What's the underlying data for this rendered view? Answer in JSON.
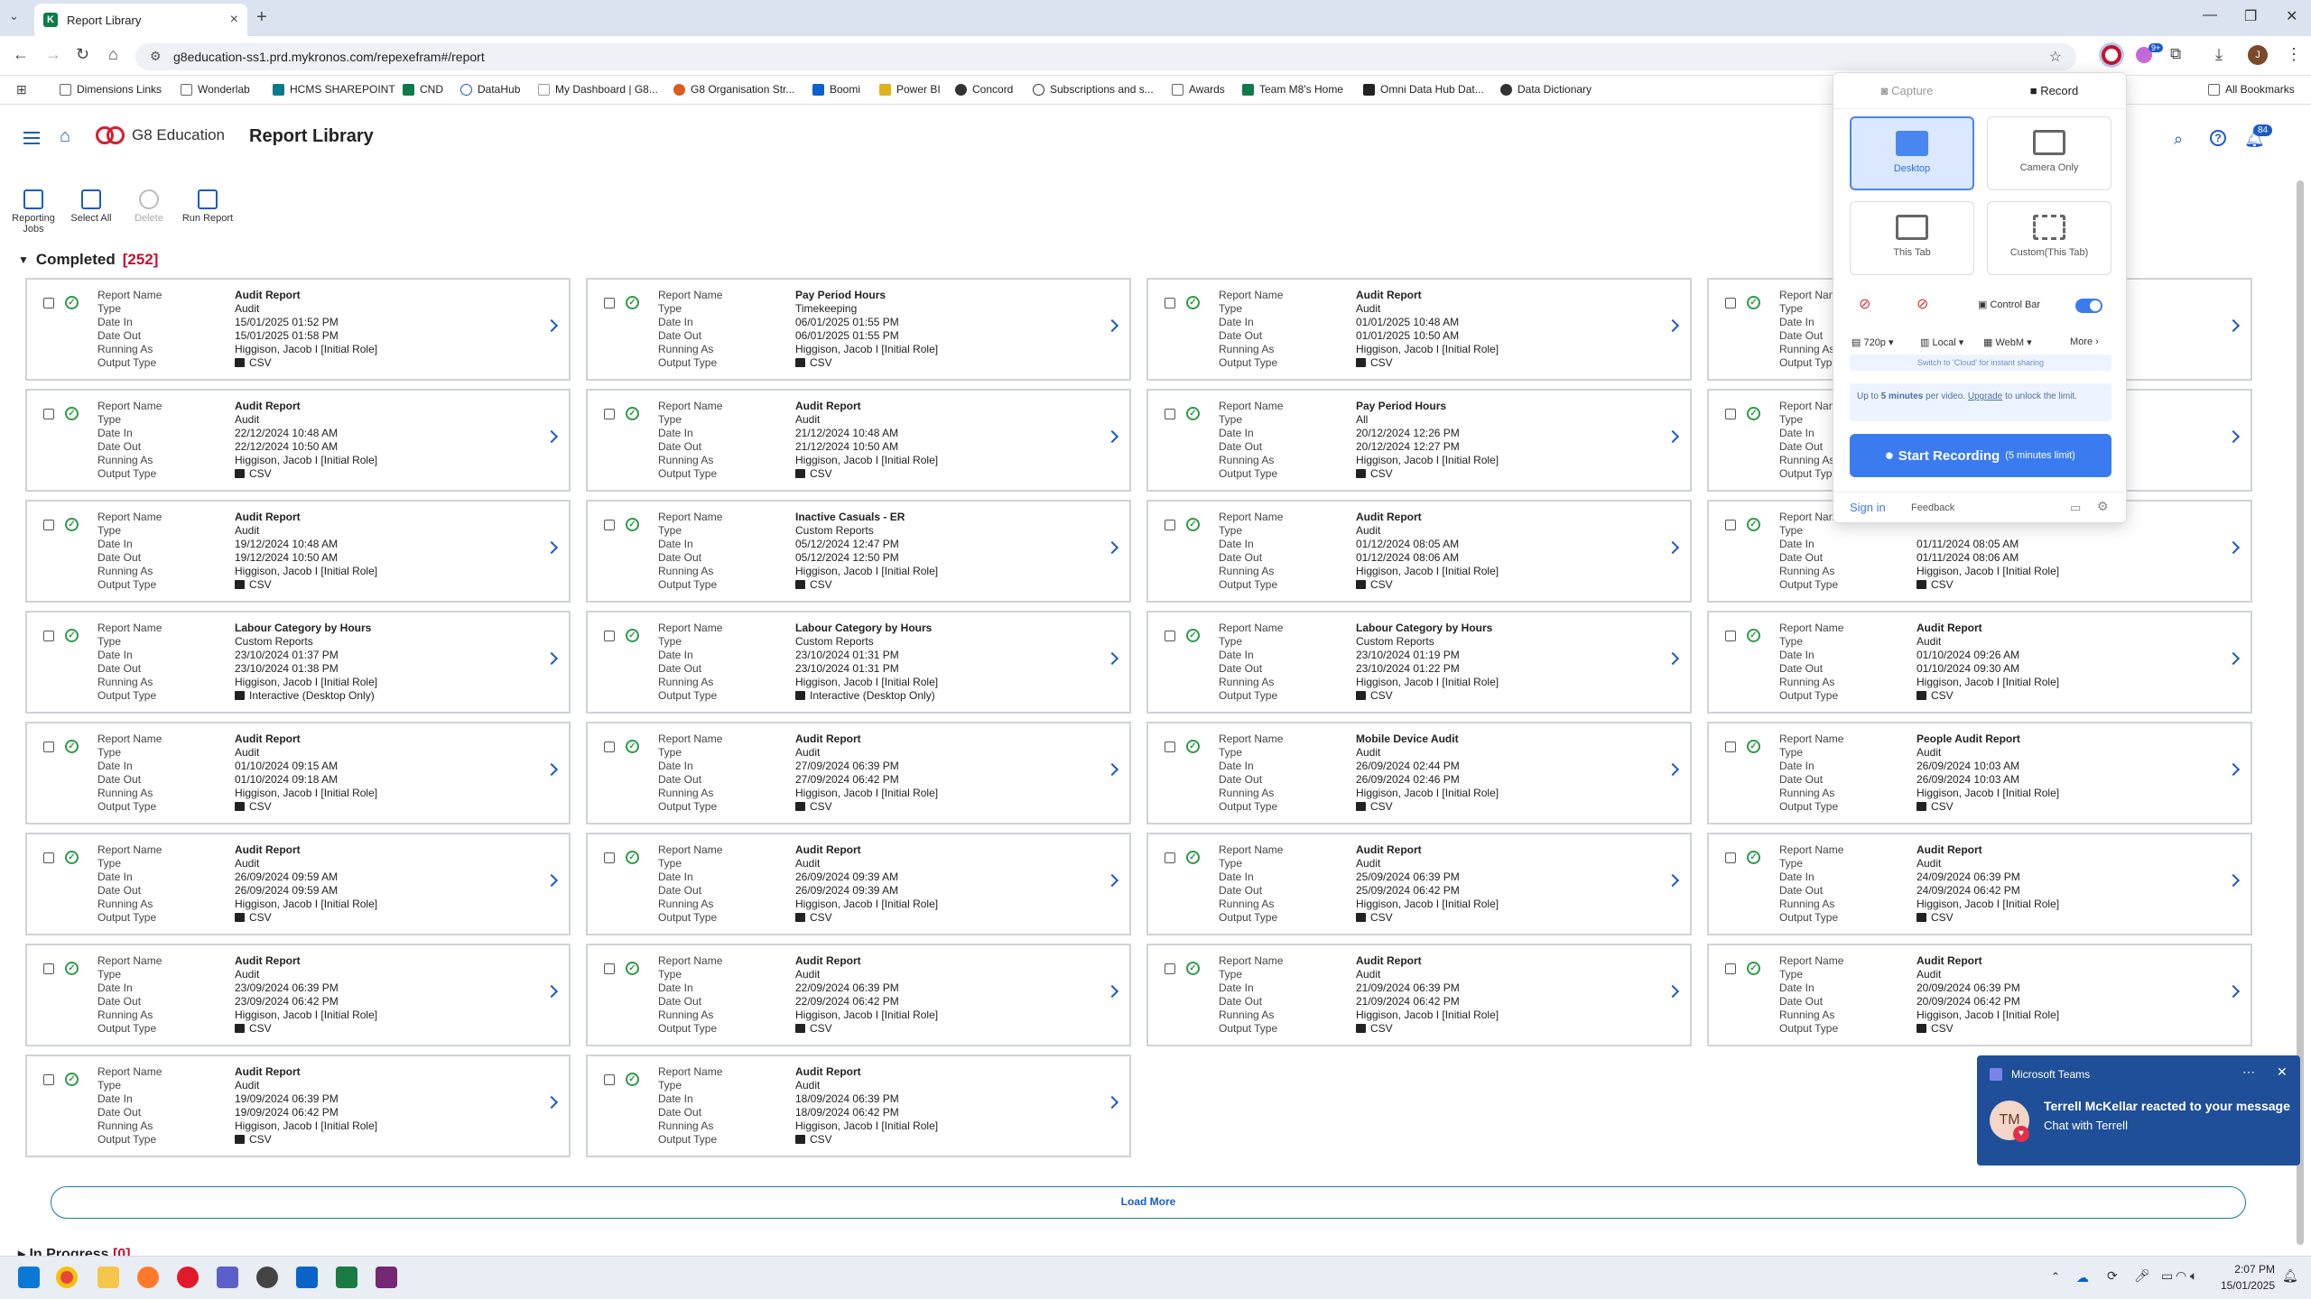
{
  "browser": {
    "tab_title": "Report Library",
    "tab_favicon": "K",
    "url": "g8education-ss1.prd.mykronos.com/repexefram#/report",
    "all_bookmarks": "All Bookmarks",
    "bookmarks": [
      {
        "label": "Dimensions Links",
        "color": "#666"
      },
      {
        "label": "Wonderlab",
        "color": "#666"
      },
      {
        "label": "HCMS SHAREPOINT",
        "color": "#0a7a8a"
      },
      {
        "label": "CND",
        "color": "#0d7a4a"
      },
      {
        "label": "DataHub",
        "color": "#1a5bc8"
      },
      {
        "label": "My Dashboard | G8...",
        "color": "#999"
      },
      {
        "label": "G8 Organisation Str...",
        "color": "#e05a1a"
      },
      {
        "label": "Boomi",
        "color": "#0a60d0"
      },
      {
        "label": "Power BI",
        "color": "#e0b21a"
      },
      {
        "label": "Concord",
        "color": "#333"
      },
      {
        "label": "Subscriptions and s...",
        "color": "#333"
      },
      {
        "label": "Awards",
        "color": "#666"
      },
      {
        "label": "Team M8's Home",
        "color": "#0d7a4a"
      },
      {
        "label": "Omni Data Hub Dat...",
        "color": "#222"
      },
      {
        "label": "Data Dictionary",
        "color": "#333"
      }
    ],
    "extension_badge": "9+"
  },
  "app": {
    "logo_text": "G8 Education",
    "page_title": "Report Library",
    "notification_count": "84"
  },
  "toolbar": {
    "reporting_jobs": "Reporting Jobs",
    "select_all": "Select All",
    "delete": "Delete",
    "run_report": "Run Report"
  },
  "completed": {
    "label": "Completed",
    "count": "[252]"
  },
  "in_progress": {
    "label": "In Progress",
    "count": "[0]"
  },
  "field_labels": {
    "name": "Report Name",
    "type": "Type",
    "date_in": "Date In",
    "date_out": "Date Out",
    "running_as": "Running As",
    "output_type": "Output Type"
  },
  "reports": [
    {
      "name": "Audit Report",
      "type": "Audit",
      "date_in": "15/01/2025 01:52 PM",
      "date_out": "15/01/2025 01:58 PM",
      "running_as": "Higgison, Jacob I [Initial Role]",
      "output": "CSV"
    },
    {
      "name": "Pay Period Hours",
      "type": "Timekeeping",
      "date_in": "06/01/2025 01:55 PM",
      "date_out": "06/01/2025 01:55 PM",
      "running_as": "Higgison, Jacob I [Initial Role]",
      "output": "CSV"
    },
    {
      "name": "Audit Report",
      "type": "Audit",
      "date_in": "01/01/2025 10:48 AM",
      "date_out": "01/01/2025 10:50 AM",
      "running_as": "Higgison, Jacob I [Initial Role]",
      "output": "CSV"
    },
    {
      "name": "",
      "type": "",
      "date_in": "",
      "date_out": "",
      "running_as": "",
      "output": ""
    },
    {
      "name": "Audit Report",
      "type": "Audit",
      "date_in": "22/12/2024 10:48 AM",
      "date_out": "22/12/2024 10:50 AM",
      "running_as": "Higgison, Jacob I [Initial Role]",
      "output": "CSV"
    },
    {
      "name": "Audit Report",
      "type": "Audit",
      "date_in": "21/12/2024 10:48 AM",
      "date_out": "21/12/2024 10:50 AM",
      "running_as": "Higgison, Jacob I [Initial Role]",
      "output": "CSV"
    },
    {
      "name": "Pay Period Hours",
      "type": "All",
      "date_in": "20/12/2024 12:26 PM",
      "date_out": "20/12/2024 12:27 PM",
      "running_as": "Higgison, Jacob I [Initial Role]",
      "output": "CSV"
    },
    {
      "name": "",
      "type": "",
      "date_in": "",
      "date_out": "",
      "running_as": "",
      "output": ""
    },
    {
      "name": "Audit Report",
      "type": "Audit",
      "date_in": "19/12/2024 10:48 AM",
      "date_out": "19/12/2024 10:50 AM",
      "running_as": "Higgison, Jacob I [Initial Role]",
      "output": "CSV"
    },
    {
      "name": "Inactive Casuals - ER",
      "type": "Custom Reports",
      "date_in": "05/12/2024 12:47 PM",
      "date_out": "05/12/2024 12:50 PM",
      "running_as": "Higgison, Jacob I [Initial Role]",
      "output": "CSV"
    },
    {
      "name": "Audit Report",
      "type": "Audit",
      "date_in": "01/12/2024 08:05 AM",
      "date_out": "01/12/2024 08:06 AM",
      "running_as": "Higgison, Jacob I [Initial Role]",
      "output": "CSV"
    },
    {
      "name": "",
      "type": "",
      "date_in": "01/11/2024 08:05 AM",
      "date_out": "01/11/2024 08:06 AM",
      "running_as": "Higgison, Jacob I [Initial Role]",
      "output": "CSV"
    },
    {
      "name": "Labour Category by Hours",
      "type": "Custom Reports",
      "date_in": "23/10/2024 01:37 PM",
      "date_out": "23/10/2024 01:38 PM",
      "running_as": "Higgison, Jacob I [Initial Role]",
      "output": "Interactive (Desktop Only)"
    },
    {
      "name": "Labour Category by Hours",
      "type": "Custom Reports",
      "date_in": "23/10/2024 01:31 PM",
      "date_out": "23/10/2024 01:31 PM",
      "running_as": "Higgison, Jacob I [Initial Role]",
      "output": "Interactive (Desktop Only)"
    },
    {
      "name": "Labour Category by Hours",
      "type": "Custom Reports",
      "date_in": "23/10/2024 01:19 PM",
      "date_out": "23/10/2024 01:22 PM",
      "running_as": "Higgison, Jacob I [Initial Role]",
      "output": "CSV"
    },
    {
      "name": "Audit Report",
      "type": "Audit",
      "date_in": "01/10/2024 09:26 AM",
      "date_out": "01/10/2024 09:30 AM",
      "running_as": "Higgison, Jacob I [Initial Role]",
      "output": "CSV"
    },
    {
      "name": "Audit Report",
      "type": "Audit",
      "date_in": "01/10/2024 09:15 AM",
      "date_out": "01/10/2024 09:18 AM",
      "running_as": "Higgison, Jacob I [Initial Role]",
      "output": "CSV"
    },
    {
      "name": "Audit Report",
      "type": "Audit",
      "date_in": "27/09/2024 06:39 PM",
      "date_out": "27/09/2024 06:42 PM",
      "running_as": "Higgison, Jacob I [Initial Role]",
      "output": "CSV"
    },
    {
      "name": "Mobile Device Audit",
      "type": "Audit",
      "date_in": "26/09/2024 02:44 PM",
      "date_out": "26/09/2024 02:46 PM",
      "running_as": "Higgison, Jacob I [Initial Role]",
      "output": "CSV"
    },
    {
      "name": "People Audit Report",
      "type": "Audit",
      "date_in": "26/09/2024 10:03 AM",
      "date_out": "26/09/2024 10:03 AM",
      "running_as": "Higgison, Jacob I [Initial Role]",
      "output": "CSV"
    },
    {
      "name": "Audit Report",
      "type": "Audit",
      "date_in": "26/09/2024 09:59 AM",
      "date_out": "26/09/2024 09:59 AM",
      "running_as": "Higgison, Jacob I [Initial Role]",
      "output": "CSV"
    },
    {
      "name": "Audit Report",
      "type": "Audit",
      "date_in": "26/09/2024 09:39 AM",
      "date_out": "26/09/2024 09:39 AM",
      "running_as": "Higgison, Jacob I [Initial Role]",
      "output": "CSV"
    },
    {
      "name": "Audit Report",
      "type": "Audit",
      "date_in": "25/09/2024 06:39 PM",
      "date_out": "25/09/2024 06:42 PM",
      "running_as": "Higgison, Jacob I [Initial Role]",
      "output": "CSV"
    },
    {
      "name": "Audit Report",
      "type": "Audit",
      "date_in": "24/09/2024 06:39 PM",
      "date_out": "24/09/2024 06:42 PM",
      "running_as": "Higgison, Jacob I [Initial Role]",
      "output": "CSV"
    },
    {
      "name": "Audit Report",
      "type": "Audit",
      "date_in": "23/09/2024 06:39 PM",
      "date_out": "23/09/2024 06:42 PM",
      "running_as": "Higgison, Jacob I [Initial Role]",
      "output": "CSV"
    },
    {
      "name": "Audit Report",
      "type": "Audit",
      "date_in": "22/09/2024 06:39 PM",
      "date_out": "22/09/2024 06:42 PM",
      "running_as": "Higgison, Jacob I [Initial Role]",
      "output": "CSV"
    },
    {
      "name": "Audit Report",
      "type": "Audit",
      "date_in": "21/09/2024 06:39 PM",
      "date_out": "21/09/2024 06:42 PM",
      "running_as": "Higgison, Jacob I [Initial Role]",
      "output": "CSV"
    },
    {
      "name": "Audit Report",
      "type": "Audit",
      "date_in": "20/09/2024 06:39 PM",
      "date_out": "20/09/2024 06:42 PM",
      "running_as": "Higgison, Jacob I [Initial Role]",
      "output": "CSV"
    },
    {
      "name": "Audit Report",
      "type": "Audit",
      "date_in": "19/09/2024 06:39 PM",
      "date_out": "19/09/2024 06:42 PM",
      "running_as": "Higgison, Jacob I [Initial Role]",
      "output": "CSV"
    },
    {
      "name": "Audit Report",
      "type": "Audit",
      "date_in": "18/09/2024 06:39 PM",
      "date_out": "18/09/2024 06:42 PM",
      "running_as": "Higgison, Jacob I [Initial Role]",
      "output": "CSV"
    }
  ],
  "load_more": "Load More",
  "recorder": {
    "tab_capture": "Capture",
    "tab_record": "Record",
    "opt_desktop": "Desktop",
    "opt_camera": "Camera Only",
    "opt_tab": "This Tab",
    "opt_custom": "Custom(This Tab)",
    "control_bar": "Control Bar",
    "resolution": "720p",
    "storage": "Local",
    "format": "WebM",
    "more": "More",
    "cloud_hint": "Switch to 'Cloud' for instant sharing",
    "limit_pre": "Up to",
    "limit_bold": "5 minutes",
    "limit_mid": "per video.",
    "limit_link": "Upgrade",
    "limit_post": "to unlock the limit.",
    "start": "Start Recording",
    "start_limit": "(5 minutes limit)",
    "sign_in": "Sign in",
    "feedback": "Feedback"
  },
  "teams": {
    "app": "Microsoft Teams",
    "initials": "TM",
    "message": "Terrell McKellar reacted to your message",
    "sub": "Chat with Terrell"
  },
  "clock": {
    "time": "2:07 PM",
    "date": "15/01/2025"
  },
  "colors": {
    "accent": "#1a5bc8",
    "brand_red": "#d41f2e",
    "success": "#2d9b46"
  }
}
